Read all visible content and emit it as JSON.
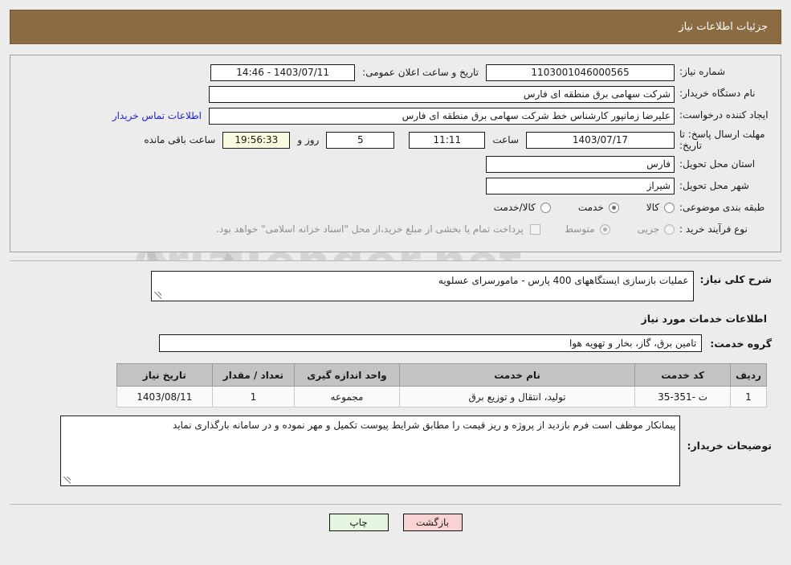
{
  "header": {
    "title": "جزئیات اطلاعات نیاز"
  },
  "info": {
    "need_number_label": "شماره نیاز:",
    "need_number_value": "1103001046000565",
    "public_announce_label": "تاریخ و ساعت اعلان عمومی:",
    "public_announce_value": "1403/07/11 - 14:46",
    "buyer_org_label": "نام دستگاه خریدار:",
    "buyer_org_value": "شرکت سهامی برق منطقه ای فارس",
    "requester_label": "ایجاد کننده درخواست:",
    "requester_value": "علیرضا زمانپور کارشناس خط شرکت سهامی برق منطقه ای فارس",
    "contact_link": "اطلاعات تماس خریدار",
    "deadline_label": "مهلت ارسال پاسخ: تا تاریخ:",
    "deadline_date": "1403/07/17",
    "hour_label": "ساعت",
    "deadline_time": "11:11",
    "remaining_days": "5",
    "days_and_label": "روز و",
    "remaining_time": "19:56:33",
    "remaining_suffix": "ساعت باقی مانده",
    "province_label": "استان محل تحویل:",
    "province_value": "فارس",
    "city_label": "شهر محل تحویل:",
    "city_value": "شیراز",
    "category_label": "طبقه بندی موضوعی:",
    "category_options": [
      {
        "label": "کالا",
        "selected": false
      },
      {
        "label": "خدمت",
        "selected": true
      },
      {
        "label": "کالا/خدمت",
        "selected": false
      }
    ],
    "process_label": "نوع فرآیند خرید :",
    "process_options": [
      {
        "label": "جزیی",
        "selected": false
      },
      {
        "label": "متوسط",
        "selected": true
      }
    ],
    "treasury_checkbox_checked": false,
    "treasury_text": "پرداخت تمام یا بخشی از مبلغ خرید،از محل \"اسناد خزانه اسلامی\" خواهد بود."
  },
  "detail": {
    "brief_label": "شرح کلی نیاز:",
    "brief_value": "عملیات بازسازی ایستگاههای 400 پارس - مامورسرای عسلویه",
    "services_heading": "اطلاعات خدمات مورد نیاز",
    "service_group_label": "گروه خدمت:",
    "service_group_value": "تامین برق، گاز، بخار و تهویه هوا"
  },
  "table": {
    "columns": [
      "ردیف",
      "کد خدمت",
      "نام خدمت",
      "واحد اندازه گیری",
      "تعداد / مقدار",
      "تاریخ نیاز"
    ],
    "rows": [
      {
        "radif": "1",
        "code": "ت -351-35",
        "name": "تولید، انتقال و توزیع برق",
        "unit": "مجموعه",
        "qty": "1",
        "date": "1403/08/11"
      }
    ]
  },
  "notes": {
    "label": "توضیحات خریدار:",
    "value": "پیمانکار موظف است فرم بازدید از پروژه و ریز قیمت را مطابق شرایط پیوست تکمیل و مهر نموده و در سامانه بارگذاری نماید"
  },
  "footer": {
    "back_button": "بازگشت",
    "print_button": "چاپ"
  },
  "watermark": {
    "text": "AriaTender.net"
  },
  "colors": {
    "header_bar": "#8a6b42",
    "page_bg": "#ececec",
    "link": "#2222cc",
    "back_button": "#f9d3d3",
    "print_button": "#e4f5e0",
    "table_header": "#c3c3c3",
    "timer_field": "#fbfbe2"
  }
}
